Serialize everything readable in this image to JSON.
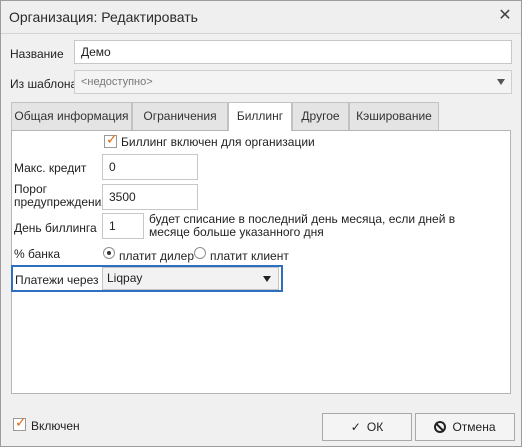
{
  "window": {
    "title": "Организация: Редактировать"
  },
  "form": {
    "name_label": "Название",
    "name_value": "Демо",
    "template_label": "Из шаблона",
    "template_value": "<недоступно>"
  },
  "tabs": [
    {
      "label": "Общая информация"
    },
    {
      "label": "Ограничения"
    },
    {
      "label": "Биллинг",
      "active": true
    },
    {
      "label": "Другое"
    },
    {
      "label": "Кэширование"
    }
  ],
  "billing": {
    "enabled_label": "Биллинг включен для организации",
    "enabled_checked": true,
    "max_credit_label": "Макс. кредит",
    "max_credit_value": "0",
    "threshold_label": "Порог предупреждения",
    "threshold_value": "3500",
    "billing_day_label": "День биллинга",
    "billing_day_value": "1",
    "billing_day_note": "будет списание в последний день месяца, если дней в месяце больше указанного дня",
    "bank_percent_label": "% банка",
    "radio_dealer_label": "платит дилер",
    "radio_client_label": "платит клиент",
    "radio_selected": "dealer",
    "payments_label": "Платежи через",
    "payments_value": "Liqpay"
  },
  "footer": {
    "enabled_label": "Включен",
    "enabled_checked": true,
    "ok_label": "ОК",
    "cancel_label": "Отмена"
  },
  "colors": {
    "focus": "#2f6fbf",
    "check": "#e06c14"
  }
}
